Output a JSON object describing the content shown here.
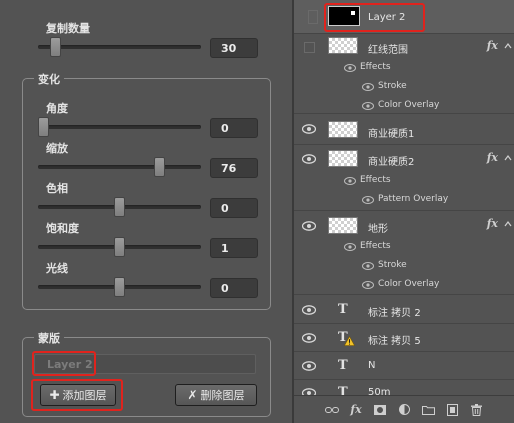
{
  "left_panel": {
    "copy_count": {
      "label": "复制数量",
      "value": "30",
      "level_pct": 8
    },
    "change_group": {
      "title": "变化",
      "angle": {
        "label": "角度",
        "value": "0",
        "level_pct": 0
      },
      "scale": {
        "label": "缩放",
        "value": "76",
        "level_pct": 76
      },
      "hue": {
        "label": "色相",
        "value": "0",
        "level_pct": 50
      },
      "saturation": {
        "label": "饱和度",
        "value": "1",
        "level_pct": 50
      },
      "light": {
        "label": "光线",
        "value": "0",
        "level_pct": 50
      }
    },
    "mask_group": {
      "title": "蒙版",
      "layer_field_value": "Layer 2",
      "add_layer_button": "添加图层",
      "delete_layer_button": "删除图层",
      "add_icon": "plus-icon",
      "delete_icon": "x-icon"
    }
  },
  "layers_panel": {
    "layers": [
      {
        "name": "Layer 2",
        "kind": "pixel-black",
        "visible": false,
        "selected": true
      },
      {
        "name": "红线范围",
        "kind": "pixel",
        "visible": false,
        "fx": "fx",
        "effects_label": "Effects",
        "effects": [
          "Stroke",
          "Color Overlay"
        ]
      },
      {
        "name": "商业硬质1",
        "kind": "pixel",
        "visible": true
      },
      {
        "name": "商业硬质2",
        "kind": "pixel",
        "visible": true,
        "fx": "fx",
        "effects_label": "Effects",
        "effects": [
          "Pattern Overlay"
        ]
      },
      {
        "name": "地形",
        "kind": "pixel",
        "visible": true,
        "fx": "fx",
        "effects_label": "Effects",
        "effects": [
          "Stroke",
          "Color Overlay"
        ]
      },
      {
        "name": "标注 拷贝 2",
        "kind": "text",
        "visible": true
      },
      {
        "name": "标注 拷贝 5",
        "kind": "text-warning",
        "visible": true
      },
      {
        "name": "N",
        "kind": "text",
        "visible": true
      },
      {
        "name": "50m",
        "kind": "text",
        "visible": true
      }
    ],
    "footer_icons": [
      "link-icon",
      "fx-icon",
      "mask-icon",
      "adjustment-icon",
      "folder-icon",
      "new-layer-icon",
      "trash-icon"
    ],
    "footer_fx": "fx"
  },
  "highlight_color": "#e0231d"
}
